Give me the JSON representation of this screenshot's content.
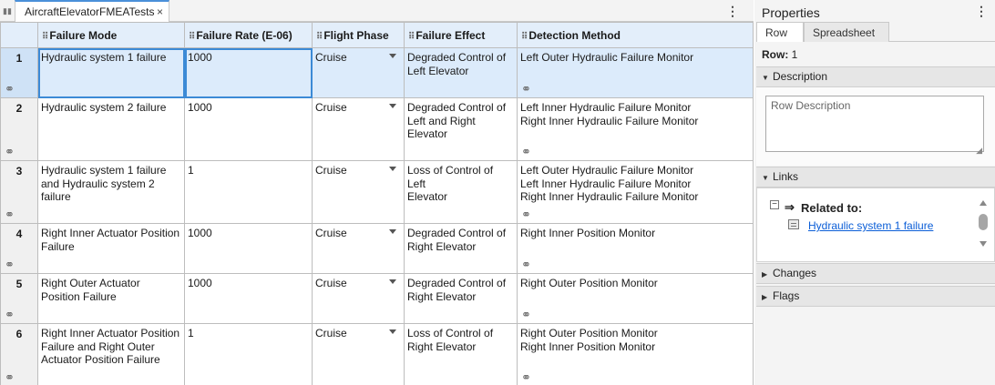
{
  "editor": {
    "tab_title": "AircraftElevatorFMEATests",
    "tab_close": "×",
    "menu_glyph": "⋮"
  },
  "table": {
    "columns": [
      "Failure Mode",
      "Failure Rate (E-06)",
      "Flight Phase",
      "Failure Effect",
      "Detection Method"
    ],
    "rows": [
      {
        "num": "1",
        "mode": [
          "Hydraulic system 1 failure"
        ],
        "rate": "1000",
        "phase": "Cruise",
        "effect": [
          "Degraded Control of",
          "Left Elevator"
        ],
        "detect": [
          "Left Outer Hydraulic Failure Monitor"
        ]
      },
      {
        "num": "2",
        "mode": [
          "Hydraulic system 2 failure"
        ],
        "rate": "1000",
        "phase": "Cruise",
        "effect": [
          "Degraded Control of",
          "Left and Right",
          "Elevator"
        ],
        "detect": [
          "Left Inner Hydraulic Failure Monitor",
          "Right Inner Hydraulic Failure Monitor"
        ]
      },
      {
        "num": "3",
        "mode": [
          "Hydraulic system 1 failure",
          "and Hydraulic system 2",
          "failure"
        ],
        "rate": "1",
        "phase": "Cruise",
        "effect": [
          "Loss of Control of Left",
          "Elevator"
        ],
        "detect": [
          "Left Outer Hydraulic Failure Monitor",
          "Left Inner Hydraulic Failure Monitor",
          "Right Inner Hydraulic Failure Monitor"
        ]
      },
      {
        "num": "4",
        "mode": [
          "Right Inner Actuator Position",
          "Failure"
        ],
        "rate": "1000",
        "phase": "Cruise",
        "effect": [
          "Degraded Control of",
          "Right Elevator"
        ],
        "detect": [
          "Right Inner Position Monitor"
        ]
      },
      {
        "num": "5",
        "mode": [
          "Right Outer Actuator",
          "Position Failure"
        ],
        "rate": "1000",
        "phase": "Cruise",
        "effect": [
          "Degraded Control of",
          "Right Elevator"
        ],
        "detect": [
          "Right Outer Position Monitor"
        ]
      },
      {
        "num": "6",
        "mode": [
          "Right Inner Actuator Position",
          "Failure and Right Outer",
          "Actuator Position Failure"
        ],
        "rate": "1",
        "phase": "Cruise",
        "effect": [
          "Loss of Control of",
          "Right Elevator"
        ],
        "detect": [
          "Right Outer Position Monitor",
          "Right Inner Position Monitor"
        ]
      }
    ]
  },
  "properties": {
    "title": "Properties",
    "menu_glyph": "⋮",
    "tabs": [
      "Row",
      "Spreadsheet"
    ],
    "row_label": "Row:",
    "row_value": "1",
    "description": {
      "header": "Description",
      "placeholder": "Row Description"
    },
    "links": {
      "header": "Links",
      "related_label": "Related to:",
      "related_item": "Hydraulic system 1 failure"
    },
    "changes_header": "Changes",
    "flags_header": "Flags"
  },
  "colors": {
    "accent": "#3c8ad6",
    "header_bg": "#e3eefa",
    "selected_row": "#dcebfb",
    "link": "#0b5ed7"
  },
  "icons": [
    "grip-icon",
    "close-icon",
    "more-options-icon",
    "link-icon",
    "dropdown-arrow-icon",
    "expand-triangle-icon",
    "collapse-triangle-icon",
    "related-arrow-icon",
    "requirement-icon"
  ]
}
